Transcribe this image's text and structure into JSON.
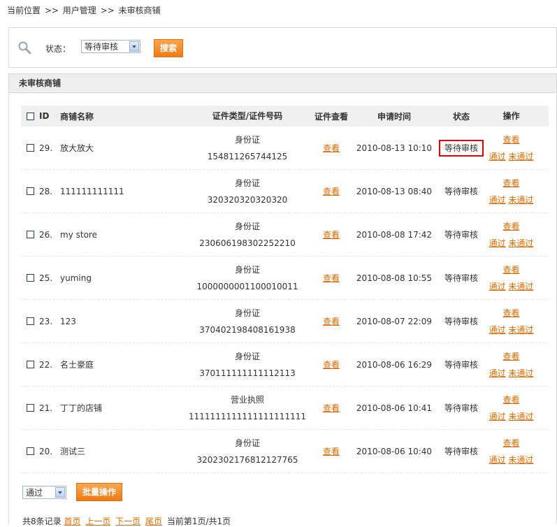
{
  "breadcrumb": {
    "current": "当前位置",
    "sep": ">>",
    "level1": "用户管理",
    "level2": "未审核商铺"
  },
  "search": {
    "status_label": "状态：",
    "status_value": "等待审核",
    "button": "搜索"
  },
  "panel": {
    "title": "未审核商铺"
  },
  "table": {
    "headers": {
      "id": "ID",
      "name": "商铺名称",
      "cert": "证件类型/证件号码",
      "view": "证件查看",
      "time": "申请时间",
      "status": "状态",
      "op": "操作"
    },
    "rows": [
      {
        "id": "29.",
        "name": "放大放大",
        "cert_type": "身份证",
        "cert_no": "154811265744125",
        "view": "查看",
        "time": "2010-08-13 10:10",
        "status": "等待审核",
        "op_view": "查看",
        "op_pass": "通过",
        "op_reject": "未通过"
      },
      {
        "id": "28.",
        "name": "111111111111",
        "cert_type": "身份证",
        "cert_no": "320320320320320",
        "view": "查看",
        "time": "2010-08-13 08:40",
        "status": "等待审核",
        "op_view": "查看",
        "op_pass": "通过",
        "op_reject": "未通过"
      },
      {
        "id": "26.",
        "name": "my store",
        "cert_type": "身份证",
        "cert_no": "230606198302252210",
        "view": "查看",
        "time": "2010-08-08 17:42",
        "status": "等待审核",
        "op_view": "查看",
        "op_pass": "通过",
        "op_reject": "未通过"
      },
      {
        "id": "25.",
        "name": "yuming",
        "cert_type": "身份证",
        "cert_no": "1000000001100010011",
        "view": "查看",
        "time": "2010-08-08 10:55",
        "status": "等待审核",
        "op_view": "查看",
        "op_pass": "通过",
        "op_reject": "未通过"
      },
      {
        "id": "23.",
        "name": "123",
        "cert_type": "身份证",
        "cert_no": "370402198408161938",
        "view": "查看",
        "time": "2010-08-07 22:09",
        "status": "等待审核",
        "op_view": "查看",
        "op_pass": "通过",
        "op_reject": "未通过"
      },
      {
        "id": "22.",
        "name": "名士豪庭",
        "cert_type": "身份证",
        "cert_no": "370111111111112113",
        "view": "查看",
        "time": "2010-08-06 16:29",
        "status": "等待审核",
        "op_view": "查看",
        "op_pass": "通过",
        "op_reject": "未通过"
      },
      {
        "id": "21.",
        "name": "丁丁的店铺",
        "cert_type": "营业执照",
        "cert_no": "1111111111111111111111",
        "view": "查看",
        "time": "2010-08-06 10:41",
        "status": "等待审核",
        "op_view": "查看",
        "op_pass": "通过",
        "op_reject": "未通过"
      },
      {
        "id": "20.",
        "name": "测试三",
        "cert_type": "身份证",
        "cert_no": "3202302176812127765",
        "view": "查看",
        "time": "2010-08-06 10:40",
        "status": "等待审核",
        "op_view": "查看",
        "op_pass": "通过",
        "op_reject": "未通过"
      }
    ]
  },
  "footer": {
    "action_value": "通过",
    "batch_button": "批量操作",
    "pager": {
      "total": "共8条记录",
      "first": "首页",
      "prev": "上一页",
      "next": "下一页",
      "last": "尾页",
      "info": "当前第1页/共1页"
    }
  }
}
